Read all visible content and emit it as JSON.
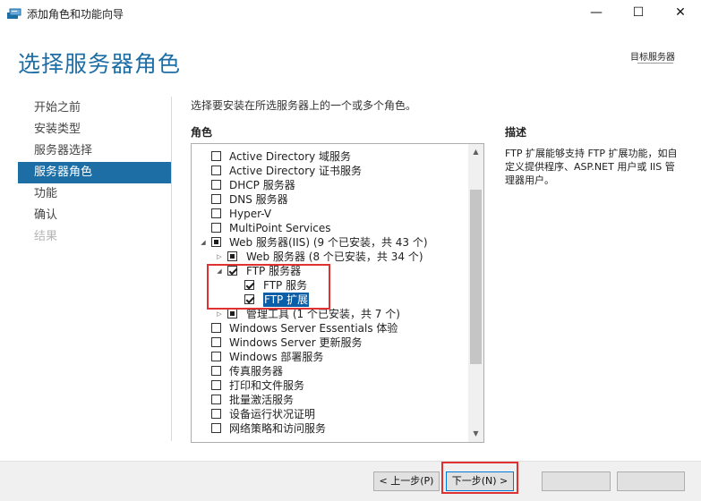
{
  "window": {
    "title": "添加角色和功能向导",
    "minimize_glyph": "—",
    "maximize_glyph": "☐",
    "close_glyph": "✕"
  },
  "header": {
    "page_title": "选择服务器角色",
    "target_server_label": "目标服务器"
  },
  "nav": {
    "items": [
      {
        "label": "开始之前",
        "state": "normal"
      },
      {
        "label": "安装类型",
        "state": "normal"
      },
      {
        "label": "服务器选择",
        "state": "normal"
      },
      {
        "label": "服务器角色",
        "state": "selected"
      },
      {
        "label": "功能",
        "state": "normal"
      },
      {
        "label": "确认",
        "state": "normal"
      },
      {
        "label": "结果",
        "state": "disabled"
      }
    ]
  },
  "main": {
    "instruction": "选择要安装在所选服务器上的一个或多个角色。",
    "roles_label": "角色",
    "roles": [
      {
        "label": "Active Directory 域服务",
        "level": 0,
        "expander": "",
        "check": "unchecked"
      },
      {
        "label": "Active Directory 证书服务",
        "level": 0,
        "expander": "",
        "check": "unchecked"
      },
      {
        "label": "DHCP 服务器",
        "level": 0,
        "expander": "",
        "check": "unchecked"
      },
      {
        "label": "DNS 服务器",
        "level": 0,
        "expander": "",
        "check": "unchecked"
      },
      {
        "label": "Hyper-V",
        "level": 0,
        "expander": "",
        "check": "unchecked"
      },
      {
        "label": "MultiPoint Services",
        "level": 0,
        "expander": "",
        "check": "unchecked"
      },
      {
        "label": "Web 服务器(IIS) (9 个已安装，共 43 个)",
        "level": 0,
        "expander": "expanded",
        "check": "partial"
      },
      {
        "label": "Web 服务器 (8 个已安装，共 34 个)",
        "level": 1,
        "expander": "collapsed",
        "check": "partial"
      },
      {
        "label": "FTP 服务器",
        "level": 1,
        "expander": "expanded",
        "check": "checked"
      },
      {
        "label": "FTP 服务",
        "level": 2,
        "expander": "",
        "check": "checked"
      },
      {
        "label": "FTP 扩展",
        "level": 2,
        "expander": "",
        "check": "checked",
        "highlight": true
      },
      {
        "label": "管理工具 (1 个已安装，共 7 个)",
        "level": 1,
        "expander": "collapsed",
        "check": "partial"
      },
      {
        "label": "Windows Server Essentials 体验",
        "level": 0,
        "expander": "",
        "check": "unchecked"
      },
      {
        "label": "Windows Server 更新服务",
        "level": 0,
        "expander": "",
        "check": "unchecked"
      },
      {
        "label": "Windows 部署服务",
        "level": 0,
        "expander": "",
        "check": "unchecked"
      },
      {
        "label": "传真服务器",
        "level": 0,
        "expander": "",
        "check": "unchecked"
      },
      {
        "label": "打印和文件服务",
        "level": 0,
        "expander": "",
        "check": "unchecked"
      },
      {
        "label": "批量激活服务",
        "level": 0,
        "expander": "",
        "check": "unchecked"
      },
      {
        "label": "设备运行状况证明",
        "level": 0,
        "expander": "",
        "check": "unchecked"
      },
      {
        "label": "网络策略和访问服务",
        "level": 0,
        "expander": "",
        "check": "unchecked"
      }
    ]
  },
  "description": {
    "heading": "描述",
    "text": "FTP 扩展能够支持 FTP 扩展功能，如自定义提供程序、ASP.NET 用户或 IIS 管理器用户。"
  },
  "footer": {
    "prev_label": "< 上一步(P)",
    "next_label": "下一步(N) >",
    "install_label": "",
    "cancel_label": ""
  },
  "colors": {
    "accent": "#1c6ea4",
    "selection": "#0a5fa8",
    "annotation_red": "#e03232"
  }
}
